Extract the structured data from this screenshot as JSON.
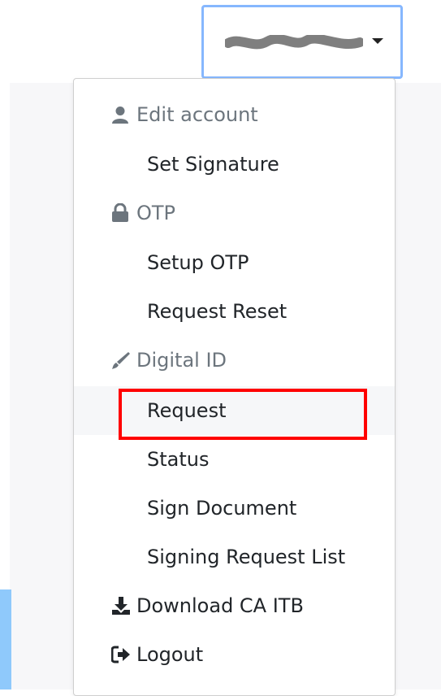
{
  "user_menu": {
    "username": "",
    "toggle_icon": "chevron-down-icon"
  },
  "menu": {
    "edit_account": {
      "label": "Edit account",
      "icon": "user-icon"
    },
    "set_signature": {
      "label": "Set Signature"
    },
    "otp": {
      "label": "OTP",
      "icon": "lock-icon"
    },
    "setup_otp": {
      "label": "Setup OTP"
    },
    "request_reset": {
      "label": "Request Reset"
    },
    "digital_id": {
      "label": "Digital ID",
      "icon": "pen-icon"
    },
    "request": {
      "label": "Request",
      "highlighted": true
    },
    "status": {
      "label": "Status"
    },
    "sign_document": {
      "label": "Sign Document"
    },
    "signing_request_list": {
      "label": "Signing Request List"
    },
    "download_ca": {
      "label": "Download CA ITB",
      "icon": "download-icon"
    },
    "logout": {
      "label": "Logout",
      "icon": "sign-out-icon"
    }
  },
  "colors": {
    "highlight": "#ff0000",
    "focus_border": "#86b7fe",
    "header_text": "#6c757d",
    "item_text": "#212529"
  }
}
